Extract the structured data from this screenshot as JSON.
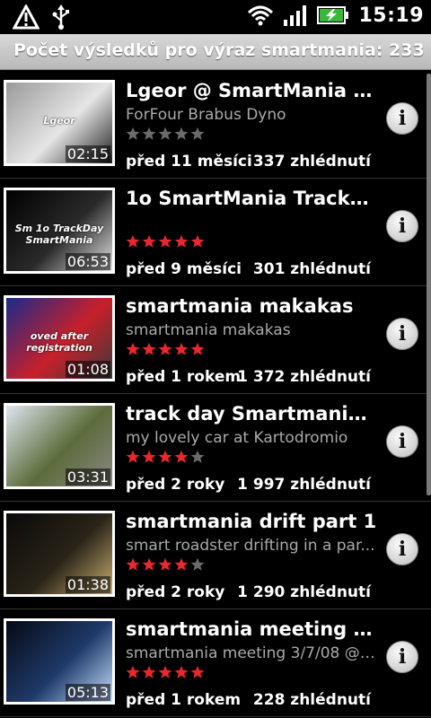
{
  "status_bar": {
    "time": "15:19",
    "left_icons": [
      "warning-icon",
      "usb-icon"
    ],
    "right_icons": [
      "wifi-icon",
      "signal-icon",
      "battery-charging-icon"
    ]
  },
  "header": {
    "text": "Počet výsledků pro výraz smartmania: 233"
  },
  "results": [
    {
      "title": "Lgeor @ SmartMania D...",
      "subtitle": "ForFour Brabus Dyno",
      "duration": "02:15",
      "rating": 0,
      "age": "před 11 měsíci",
      "views": "337 zhlédnutí",
      "thumb_overlay": "Lgeor",
      "thumb_colors": [
        "#9a9a9a",
        "#e5e5e5",
        "#202020"
      ]
    },
    {
      "title": "1o SmartMania TrackD...",
      "subtitle": "",
      "duration": "06:53",
      "rating": 5,
      "age": "před 9 měsíci",
      "views": "301 zhlédnutí",
      "thumb_overlay": "Sm 1o TrackDay SmartMania",
      "thumb_colors": [
        "#000000",
        "#2a2a2a",
        "#e5e5e5"
      ]
    },
    {
      "title": "smartmania makakas",
      "subtitle": "smartmania makakas",
      "duration": "01:08",
      "rating": 5,
      "age": "před 1 rokem",
      "views": "1 372 zhlédnutí",
      "thumb_overlay": "oved after registration",
      "thumb_colors": [
        "#1a2a8a",
        "#c8202a",
        "#3a3a3a"
      ]
    },
    {
      "title": "track day Smartmania....",
      "subtitle": "my lovely car at Kartodromio",
      "duration": "03:31",
      "rating": 4,
      "age": "před 2 roky",
      "views": "1 997 zhlédnutí",
      "thumb_overlay": "",
      "thumb_colors": [
        "#dfe5ef",
        "#5c6b3a",
        "#8a8a88"
      ]
    },
    {
      "title": "smartmania drift part 1",
      "subtitle": "smart roadster drifting in a par...",
      "duration": "01:38",
      "rating": 4,
      "age": "před 2 roky",
      "views": "1 290 zhlédnutí",
      "thumb_overlay": "",
      "thumb_colors": [
        "#0a0a0a",
        "#2a2418",
        "#c8b070"
      ]
    },
    {
      "title": "smartmania meeting 3...",
      "subtitle": "smartmania meeting 3/7/08 @ ...",
      "duration": "05:13",
      "rating": 5,
      "age": "před 1 rokem",
      "views": "228 zhlédnutí",
      "thumb_overlay": "",
      "thumb_colors": [
        "#050a14",
        "#1f3a6a",
        "#c8e2ff"
      ]
    }
  ],
  "info_button_glyph": "i",
  "colors": {
    "star_filled": "#e8282e",
    "star_empty": "#6b6b6b"
  }
}
